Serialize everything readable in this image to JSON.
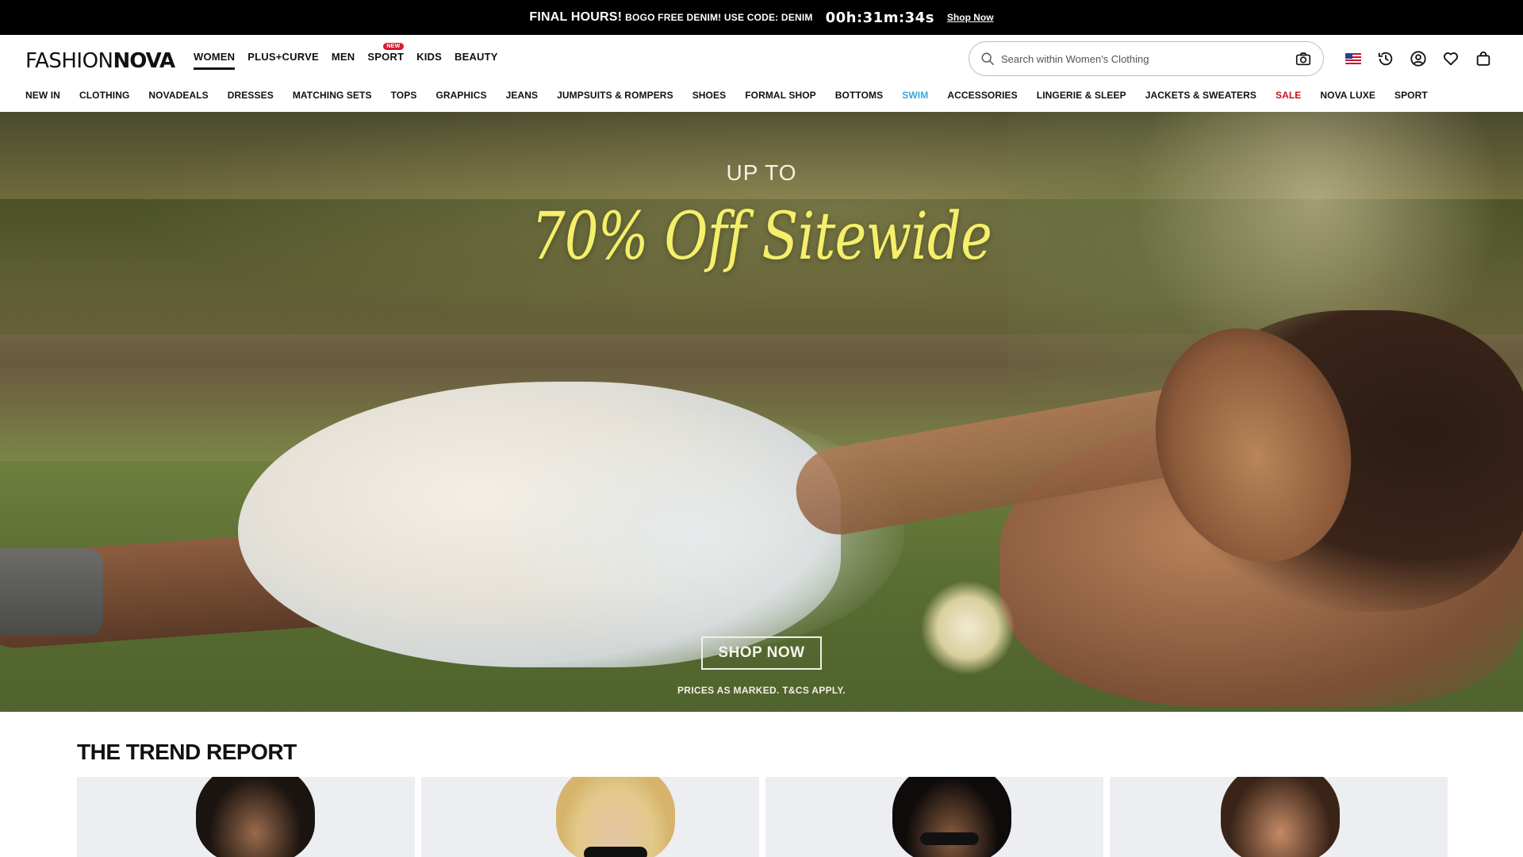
{
  "promo": {
    "headline": "FINAL HOURS!",
    "message": "BOGO FREE DENIM! USE CODE: DENIM",
    "timer": "00h:31m:34s",
    "link": "Shop Now"
  },
  "header": {
    "logo_light": "FASHION",
    "logo_bold": "NOVA",
    "departments": [
      {
        "label": "WOMEN",
        "active": true
      },
      {
        "label": "PLUS+CURVE"
      },
      {
        "label": "MEN"
      },
      {
        "label": "SPORT",
        "badge": "NEW"
      },
      {
        "label": "KIDS"
      },
      {
        "label": "BEAUTY"
      }
    ],
    "search_placeholder": "Search within Women's Clothing"
  },
  "categories": [
    "NEW IN",
    "CLOTHING",
    "NOVADEALS",
    "DRESSES",
    "MATCHING SETS",
    "TOPS",
    "GRAPHICS",
    "JEANS",
    "JUMPSUITS & ROMPERS",
    "SHOES",
    "FORMAL SHOP",
    "BOTTOMS",
    "SWIM",
    "ACCESSORIES",
    "LINGERIE & SLEEP",
    "JACKETS & SWEATERS",
    "SALE",
    "NOVA LUXE",
    "SPORT"
  ],
  "hero": {
    "pre": "UP TO",
    "headline": "70% Off Sitewide",
    "cta": "SHOP NOW",
    "terms": "PRICES AS MARKED. T&CS APPLY."
  },
  "trend": {
    "title": "THE TREND REPORT"
  },
  "colors": {
    "swim": "#37a9de",
    "sale": "#c3161c",
    "headline": "#f5ef6a",
    "badge": "#d21d2f"
  }
}
